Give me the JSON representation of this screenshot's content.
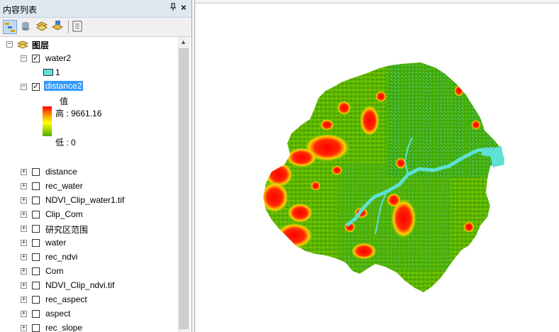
{
  "panel": {
    "title": "内容列表",
    "pin_glyph": "ᵖ",
    "close_glyph": "×"
  },
  "toolbar": {
    "buttons": [
      "list-by-drawing-order-icon",
      "list-by-source-icon",
      "list-by-visibility-icon",
      "list-by-selection-icon",
      "options-icon"
    ]
  },
  "tree": {
    "root_label": "图层",
    "water2": {
      "label": "water2",
      "class_label": "1",
      "swatch_color": "#5ee0d4"
    },
    "distance2": {
      "label": "distance2",
      "legend_title": "值",
      "high": "高 : 9661.16",
      "low": "低 : 0"
    },
    "layers": [
      "distance",
      "rec_water",
      "NDVI_Clip_water1.tif",
      "Clip_Com",
      "研究区范围",
      "water",
      "rec_ndvi",
      "Com",
      "NDVI_Clip_ndvi.tif",
      "rec_aspect",
      "aspect",
      "rec_slope"
    ]
  },
  "colors": {
    "ramp_high": "#ff0000",
    "ramp_mid": "#ffff00",
    "ramp_low": "#4caf00",
    "water": "#5ee0d4",
    "selection": "#3399ff"
  }
}
